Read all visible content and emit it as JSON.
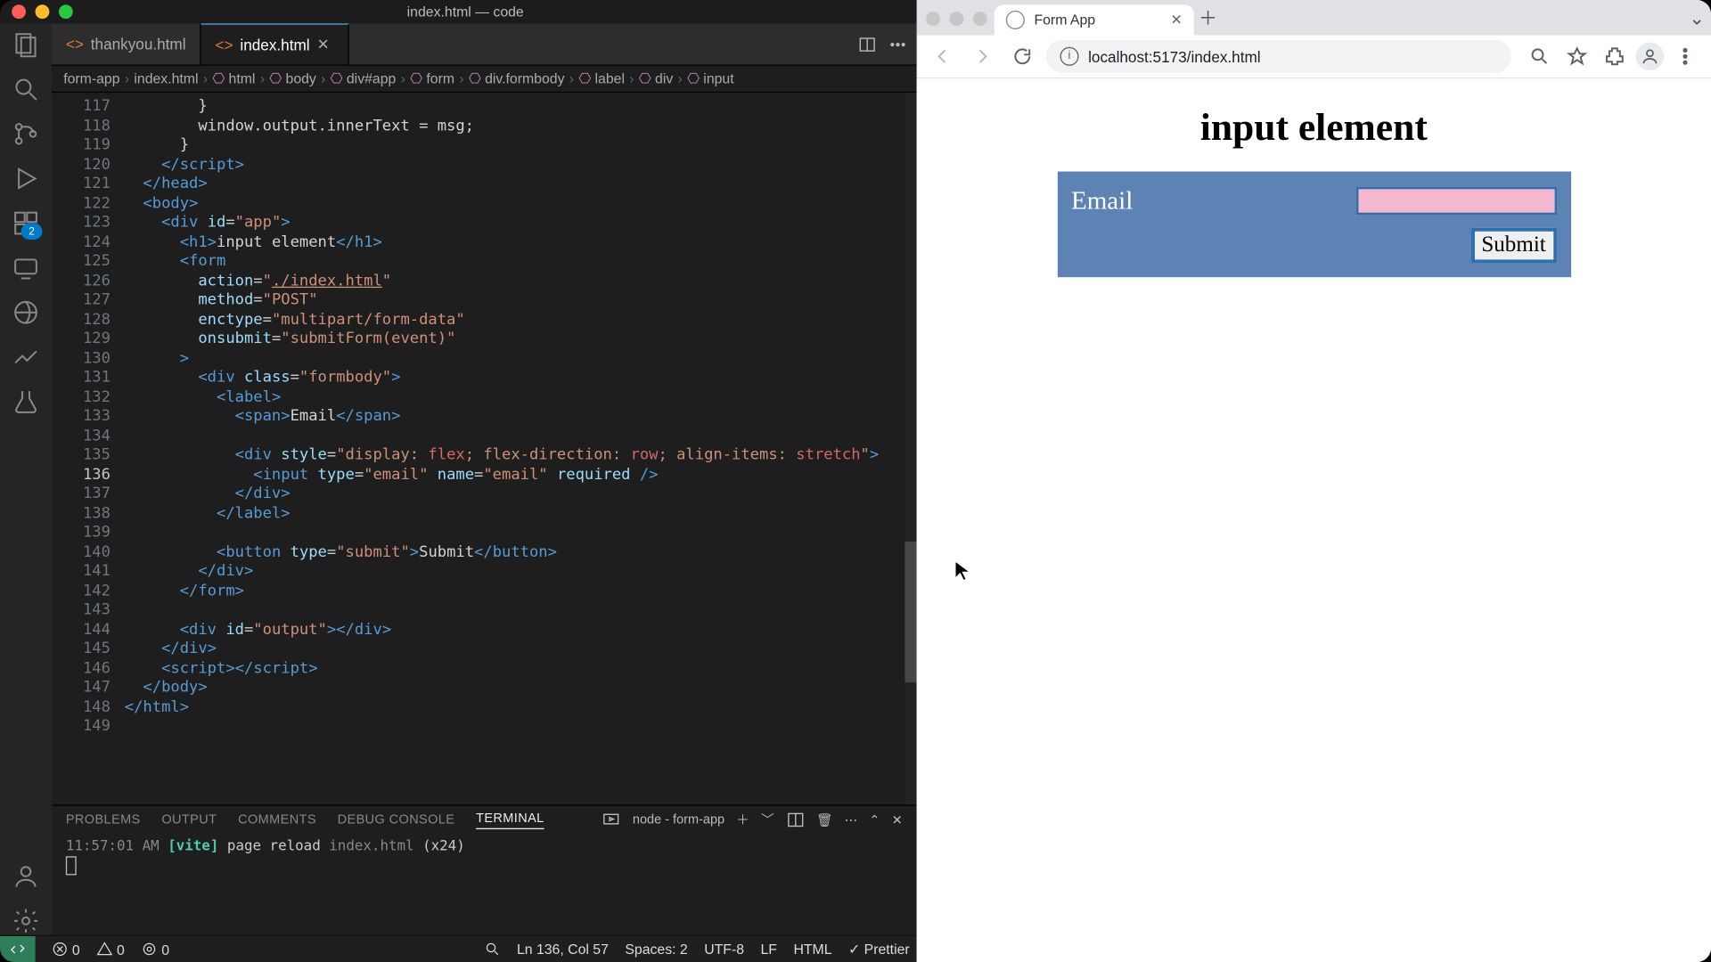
{
  "vscode": {
    "window_title": "index.html — code",
    "traffic_lights": {
      "close": "#ff5f57",
      "min": "#febc2e",
      "max": "#28c840"
    },
    "activity": {
      "extensions_badge": "2",
      "items": [
        {
          "name": "files-icon"
        },
        {
          "name": "search-icon"
        },
        {
          "name": "source-control-icon"
        },
        {
          "name": "run-debug-icon"
        },
        {
          "name": "extensions-icon"
        },
        {
          "name": "remote-explorer-icon"
        },
        {
          "name": "live-share-icon"
        },
        {
          "name": "graph-icon"
        },
        {
          "name": "beaker-icon"
        }
      ],
      "bottom": [
        {
          "name": "account-icon"
        },
        {
          "name": "gear-icon"
        }
      ]
    },
    "tabs": [
      {
        "icon": "html-file-icon",
        "label": "thankyou.html",
        "active": false,
        "close": false
      },
      {
        "icon": "html-file-icon",
        "label": "index.html",
        "active": true,
        "close": true
      }
    ],
    "crumbs": [
      "form-app",
      "index.html",
      "html",
      "body",
      "div#app",
      "form",
      "div.formbody",
      "label",
      "div",
      "input"
    ],
    "editor": {
      "current_line": 136,
      "lines": [
        {
          "n": 117,
          "html": "        <span class='t-txt'>}</span>"
        },
        {
          "n": 118,
          "html": "        <span class='t-txt'>window.output.innerText = msg;</span>"
        },
        {
          "n": 119,
          "html": "      <span class='t-txt'>}</span>"
        },
        {
          "n": 120,
          "html": "    <span class='t-tag'>&lt;/script&gt;</span>"
        },
        {
          "n": 121,
          "html": "  <span class='t-tag'>&lt;/head&gt;</span>"
        },
        {
          "n": 122,
          "html": "  <span class='t-tag'>&lt;body&gt;</span>"
        },
        {
          "n": 123,
          "html": "    <span class='t-tag'>&lt;div</span> <span class='t-attr'>id</span>=<span class='t-str'>\"app\"</span><span class='t-tag'>&gt;</span>"
        },
        {
          "n": 124,
          "html": "      <span class='t-tag'>&lt;h1&gt;</span><span class='t-txt'>input element</span><span class='t-tag'>&lt;/h1&gt;</span>"
        },
        {
          "n": 125,
          "html": "      <span class='t-tag'>&lt;form</span>"
        },
        {
          "n": 126,
          "html": "        <span class='t-attr'>action</span>=<span class='t-str'>\"<u>./index.html</u>\"</span>"
        },
        {
          "n": 127,
          "html": "        <span class='t-attr'>method</span>=<span class='t-str'>\"POST\"</span>"
        },
        {
          "n": 128,
          "html": "        <span class='t-attr'>enctype</span>=<span class='t-str'>\"multipart/form-data\"</span>"
        },
        {
          "n": 129,
          "html": "        <span class='t-attr'>onsubmit</span>=<span class='t-str'>\"submitForm(event)\"</span>"
        },
        {
          "n": 130,
          "html": "      <span class='t-tag'>&gt;</span>"
        },
        {
          "n": 131,
          "html": "        <span class='t-tag'>&lt;div</span> <span class='t-attr'>class</span>=<span class='t-str'>\"formbody\"</span><span class='t-tag'>&gt;</span>"
        },
        {
          "n": 132,
          "html": "          <span class='t-tag'>&lt;label&gt;</span>"
        },
        {
          "n": 133,
          "html": "            <span class='t-tag'>&lt;span&gt;</span><span class='t-txt'>Email</span><span class='t-tag'>&lt;/span&gt;</span>"
        },
        {
          "n": 134,
          "html": ""
        },
        {
          "n": 135,
          "html": "            <span class='t-tag'>&lt;div</span> <span class='t-attr'>style</span>=<span class='t-str'>\"display: </span><span class='t-br'>flex</span><span class='t-str'>; flex-direction: </span><span class='t-br'>row</span><span class='t-str'>; align-items: </span><span class='t-br'>stretch</span><span class='t-str'>\"</span><span class='t-tag'>&gt;</span>"
        },
        {
          "n": 136,
          "html": "              <span class='t-tag'>&lt;input</span> <span class='t-attr'>type</span>=<span class='t-str'>\"email\"</span> <span class='t-attr'>name</span>=<span class='t-str'>\"email\"</span> <span class='t-attr'>required</span> <span class='t-tag'>/&gt;</span>"
        },
        {
          "n": 137,
          "html": "            <span class='t-tag'>&lt;/div&gt;</span>"
        },
        {
          "n": 138,
          "html": "          <span class='t-tag'>&lt;/label&gt;</span>"
        },
        {
          "n": 139,
          "html": ""
        },
        {
          "n": 140,
          "html": "          <span class='t-tag'>&lt;button</span> <span class='t-attr'>type</span>=<span class='t-str'>\"submit\"</span><span class='t-tag'>&gt;</span><span class='t-txt'>Submit</span><span class='t-tag'>&lt;/button&gt;</span>"
        },
        {
          "n": 141,
          "html": "        <span class='t-tag'>&lt;/div&gt;</span>"
        },
        {
          "n": 142,
          "html": "      <span class='t-tag'>&lt;/form&gt;</span>"
        },
        {
          "n": 143,
          "html": ""
        },
        {
          "n": 144,
          "html": "      <span class='t-tag'>&lt;div</span> <span class='t-attr'>id</span>=<span class='t-str'>\"output\"</span><span class='t-tag'>&gt;&lt;/div&gt;</span>"
        },
        {
          "n": 145,
          "html": "    <span class='t-tag'>&lt;/div&gt;</span>"
        },
        {
          "n": 146,
          "html": "    <span class='t-tag'>&lt;script&gt;&lt;/script&gt;</span>"
        },
        {
          "n": 147,
          "html": "  <span class='t-tag'>&lt;/body&gt;</span>"
        },
        {
          "n": 148,
          "html": "<span class='t-tag'>&lt;/html&gt;</span>"
        },
        {
          "n": 149,
          "html": ""
        }
      ]
    },
    "panel": {
      "tabs": [
        "PROBLEMS",
        "OUTPUT",
        "COMMENTS",
        "DEBUG CONSOLE",
        "TERMINAL"
      ],
      "active": "TERMINAL",
      "task_label": "node - form-app",
      "terminal": {
        "time": "11:57:01 AM",
        "tag": "[vite]",
        "msg": "page reload",
        "file": "index.html",
        "count": "(x24)"
      }
    },
    "status": {
      "errors": "0",
      "warnings": "0",
      "ports": "0",
      "cursor": "Ln 136, Col 57",
      "spaces": "Spaces: 2",
      "enc": "UTF-8",
      "eol": "LF",
      "lang": "HTML",
      "fmt": "✓ Prettier"
    }
  },
  "chrome": {
    "tab_title": "Form App",
    "url": "localhost:5173/index.html",
    "page": {
      "heading": "input element",
      "email_label": "Email",
      "submit": "Submit"
    }
  }
}
